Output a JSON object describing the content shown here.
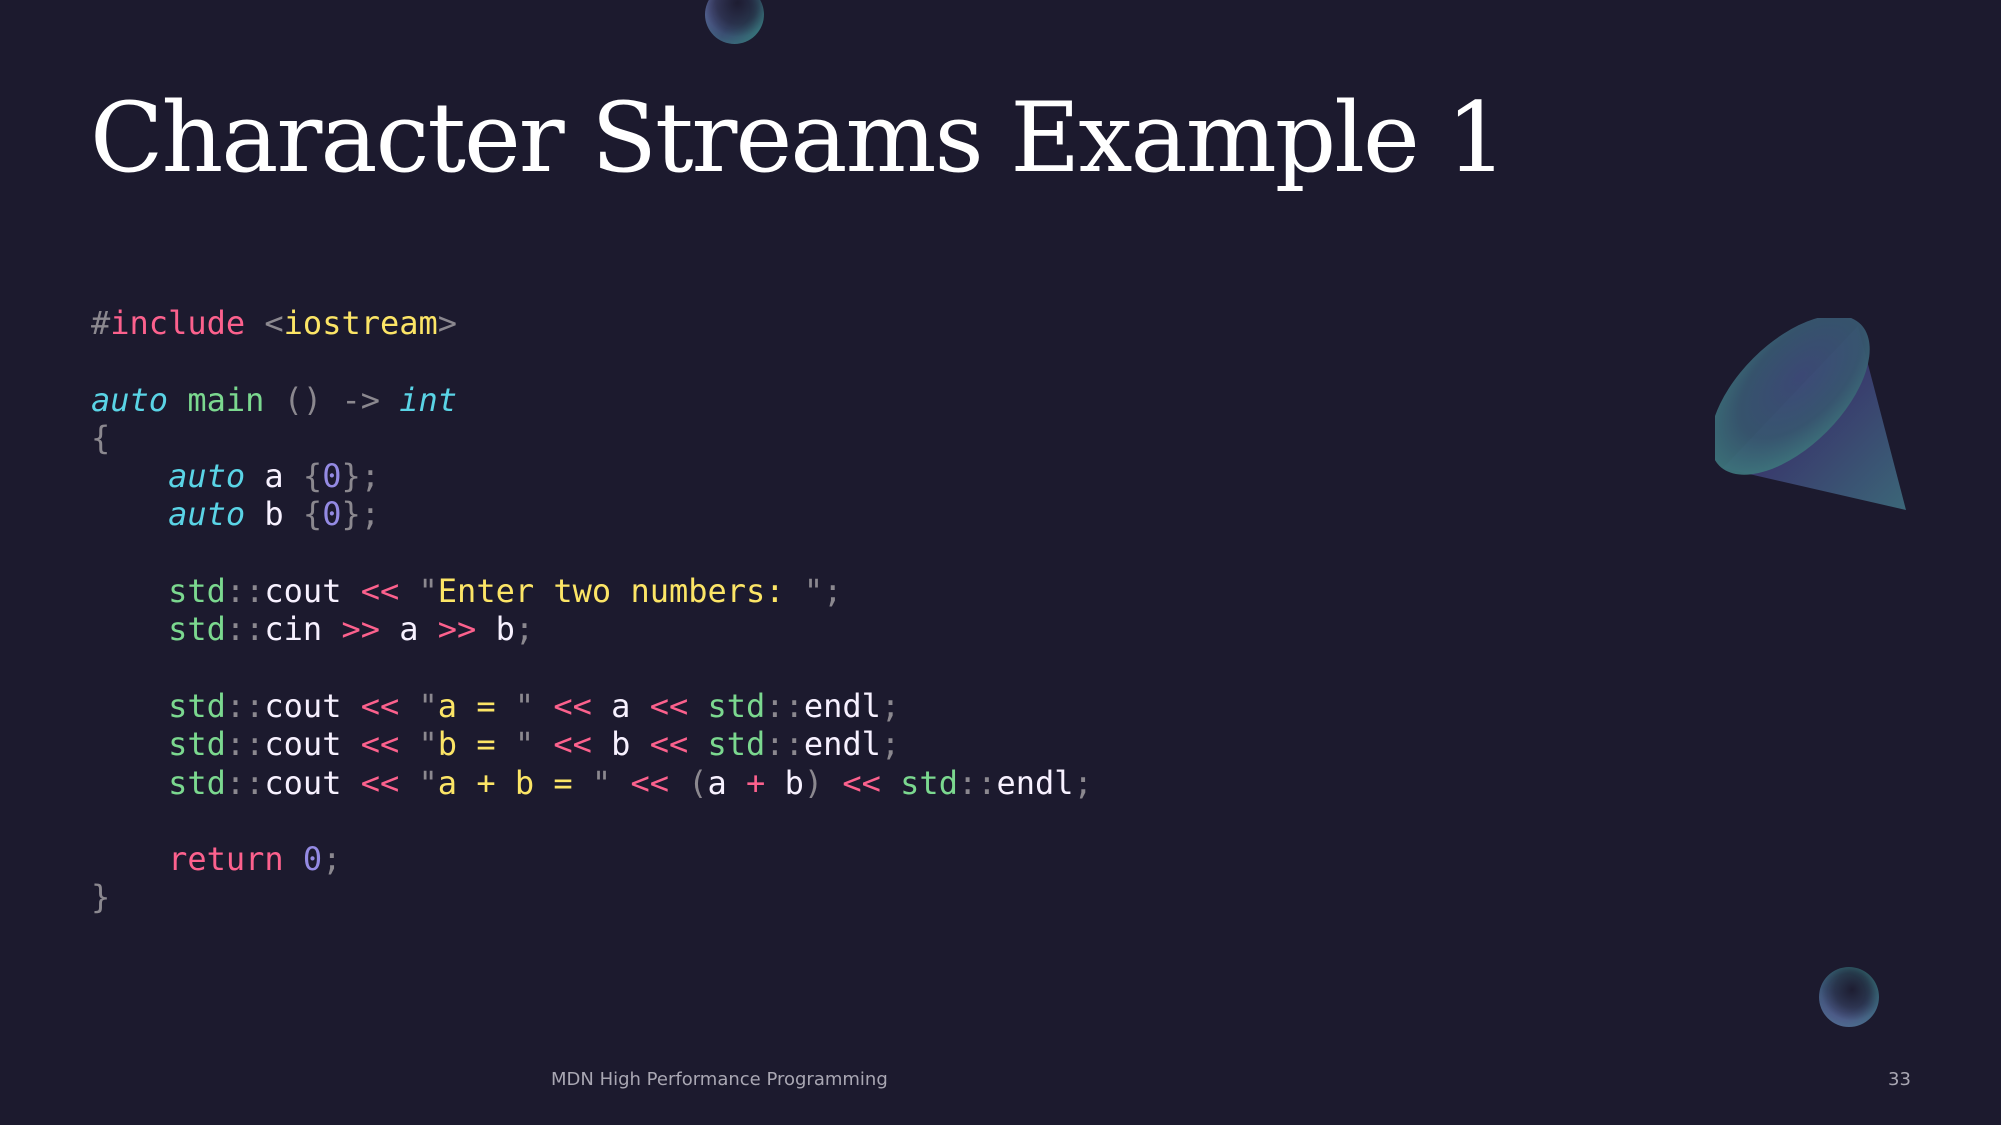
{
  "slide": {
    "title": "Character Streams Example 1",
    "footer": "MDN High Performance Programming",
    "page_number": "33"
  },
  "colors": {
    "background": "#1c1a2e",
    "punctuation": "#8b888f",
    "keyword": "#fc618d",
    "string": "#fce566",
    "type": "#5ad4e6",
    "function": "#7bd88f",
    "number": "#948ae3",
    "identifier": "#f7f1ff"
  },
  "decorations": [
    "sphere-icon",
    "cone-icon",
    "sphere-icon"
  ],
  "code": {
    "language": "cpp",
    "lines": [
      [
        {
          "t": "#",
          "c": "punct"
        },
        {
          "t": "include",
          "c": "keyword"
        },
        {
          "t": " ",
          "c": "plain"
        },
        {
          "t": "<",
          "c": "punct"
        },
        {
          "t": "iostream",
          "c": "string"
        },
        {
          "t": ">",
          "c": "punct"
        }
      ],
      [],
      [
        {
          "t": "auto",
          "c": "type"
        },
        {
          "t": " ",
          "c": "plain"
        },
        {
          "t": "main",
          "c": "func"
        },
        {
          "t": " ",
          "c": "plain"
        },
        {
          "t": "()",
          "c": "punct"
        },
        {
          "t": " ",
          "c": "plain"
        },
        {
          "t": "->",
          "c": "punct"
        },
        {
          "t": " ",
          "c": "plain"
        },
        {
          "t": "int",
          "c": "type"
        }
      ],
      [
        {
          "t": "{",
          "c": "punct"
        }
      ],
      [
        {
          "t": "    ",
          "c": "plain"
        },
        {
          "t": "auto",
          "c": "type"
        },
        {
          "t": " ",
          "c": "plain"
        },
        {
          "t": "a",
          "c": "ident"
        },
        {
          "t": " ",
          "c": "plain"
        },
        {
          "t": "{",
          "c": "punct"
        },
        {
          "t": "0",
          "c": "number"
        },
        {
          "t": "};",
          "c": "punct"
        }
      ],
      [
        {
          "t": "    ",
          "c": "plain"
        },
        {
          "t": "auto",
          "c": "type"
        },
        {
          "t": " ",
          "c": "plain"
        },
        {
          "t": "b",
          "c": "ident"
        },
        {
          "t": " ",
          "c": "plain"
        },
        {
          "t": "{",
          "c": "punct"
        },
        {
          "t": "0",
          "c": "number"
        },
        {
          "t": "};",
          "c": "punct"
        }
      ],
      [],
      [
        {
          "t": "    ",
          "c": "plain"
        },
        {
          "t": "std",
          "c": "ns"
        },
        {
          "t": "::",
          "c": "punct"
        },
        {
          "t": "cout",
          "c": "ident"
        },
        {
          "t": " ",
          "c": "plain"
        },
        {
          "t": "<<",
          "c": "op"
        },
        {
          "t": " ",
          "c": "plain"
        },
        {
          "t": "\"",
          "c": "punct"
        },
        {
          "t": "Enter two numbers: ",
          "c": "string"
        },
        {
          "t": "\";",
          "c": "punct"
        }
      ],
      [
        {
          "t": "    ",
          "c": "plain"
        },
        {
          "t": "std",
          "c": "ns"
        },
        {
          "t": "::",
          "c": "punct"
        },
        {
          "t": "cin",
          "c": "ident"
        },
        {
          "t": " ",
          "c": "plain"
        },
        {
          "t": ">>",
          "c": "op"
        },
        {
          "t": " ",
          "c": "plain"
        },
        {
          "t": "a",
          "c": "ident"
        },
        {
          "t": " ",
          "c": "plain"
        },
        {
          "t": ">>",
          "c": "op"
        },
        {
          "t": " ",
          "c": "plain"
        },
        {
          "t": "b",
          "c": "ident"
        },
        {
          "t": ";",
          "c": "punct"
        }
      ],
      [],
      [
        {
          "t": "    ",
          "c": "plain"
        },
        {
          "t": "std",
          "c": "ns"
        },
        {
          "t": "::",
          "c": "punct"
        },
        {
          "t": "cout",
          "c": "ident"
        },
        {
          "t": " ",
          "c": "plain"
        },
        {
          "t": "<<",
          "c": "op"
        },
        {
          "t": " ",
          "c": "plain"
        },
        {
          "t": "\"",
          "c": "punct"
        },
        {
          "t": "a = ",
          "c": "string"
        },
        {
          "t": "\"",
          "c": "punct"
        },
        {
          "t": " ",
          "c": "plain"
        },
        {
          "t": "<<",
          "c": "op"
        },
        {
          "t": " ",
          "c": "plain"
        },
        {
          "t": "a",
          "c": "ident"
        },
        {
          "t": " ",
          "c": "plain"
        },
        {
          "t": "<<",
          "c": "op"
        },
        {
          "t": " ",
          "c": "plain"
        },
        {
          "t": "std",
          "c": "ns"
        },
        {
          "t": "::",
          "c": "punct"
        },
        {
          "t": "endl",
          "c": "ident"
        },
        {
          "t": ";",
          "c": "punct"
        }
      ],
      [
        {
          "t": "    ",
          "c": "plain"
        },
        {
          "t": "std",
          "c": "ns"
        },
        {
          "t": "::",
          "c": "punct"
        },
        {
          "t": "cout",
          "c": "ident"
        },
        {
          "t": " ",
          "c": "plain"
        },
        {
          "t": "<<",
          "c": "op"
        },
        {
          "t": " ",
          "c": "plain"
        },
        {
          "t": "\"",
          "c": "punct"
        },
        {
          "t": "b = ",
          "c": "string"
        },
        {
          "t": "\"",
          "c": "punct"
        },
        {
          "t": " ",
          "c": "plain"
        },
        {
          "t": "<<",
          "c": "op"
        },
        {
          "t": " ",
          "c": "plain"
        },
        {
          "t": "b",
          "c": "ident"
        },
        {
          "t": " ",
          "c": "plain"
        },
        {
          "t": "<<",
          "c": "op"
        },
        {
          "t": " ",
          "c": "plain"
        },
        {
          "t": "std",
          "c": "ns"
        },
        {
          "t": "::",
          "c": "punct"
        },
        {
          "t": "endl",
          "c": "ident"
        },
        {
          "t": ";",
          "c": "punct"
        }
      ],
      [
        {
          "t": "    ",
          "c": "plain"
        },
        {
          "t": "std",
          "c": "ns"
        },
        {
          "t": "::",
          "c": "punct"
        },
        {
          "t": "cout",
          "c": "ident"
        },
        {
          "t": " ",
          "c": "plain"
        },
        {
          "t": "<<",
          "c": "op"
        },
        {
          "t": " ",
          "c": "plain"
        },
        {
          "t": "\"",
          "c": "punct"
        },
        {
          "t": "a + b = ",
          "c": "string"
        },
        {
          "t": "\"",
          "c": "punct"
        },
        {
          "t": " ",
          "c": "plain"
        },
        {
          "t": "<<",
          "c": "op"
        },
        {
          "t": " ",
          "c": "plain"
        },
        {
          "t": "(",
          "c": "punct"
        },
        {
          "t": "a",
          "c": "ident"
        },
        {
          "t": " ",
          "c": "plain"
        },
        {
          "t": "+",
          "c": "op"
        },
        {
          "t": " ",
          "c": "plain"
        },
        {
          "t": "b",
          "c": "ident"
        },
        {
          "t": ")",
          "c": "punct"
        },
        {
          "t": " ",
          "c": "plain"
        },
        {
          "t": "<<",
          "c": "op"
        },
        {
          "t": " ",
          "c": "plain"
        },
        {
          "t": "std",
          "c": "ns"
        },
        {
          "t": "::",
          "c": "punct"
        },
        {
          "t": "endl",
          "c": "ident"
        },
        {
          "t": ";",
          "c": "punct"
        }
      ],
      [],
      [
        {
          "t": "    ",
          "c": "plain"
        },
        {
          "t": "return",
          "c": "keyword"
        },
        {
          "t": " ",
          "c": "plain"
        },
        {
          "t": "0",
          "c": "number"
        },
        {
          "t": ";",
          "c": "punct"
        }
      ],
      [
        {
          "t": "}",
          "c": "punct"
        }
      ]
    ]
  }
}
